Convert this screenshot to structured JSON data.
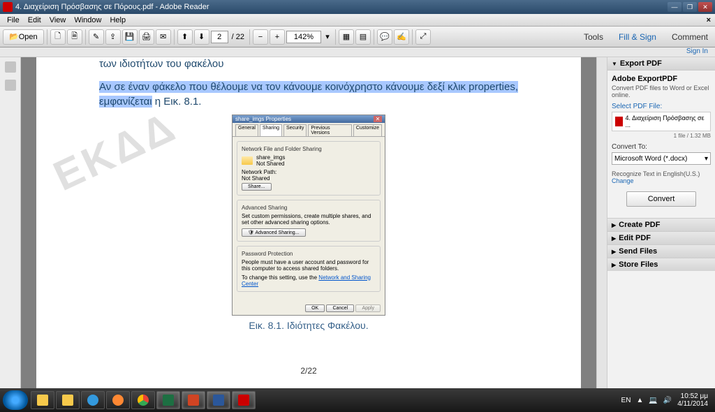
{
  "window": {
    "title": "4. Διαχείριση Πρόσβασης σε Πόρους.pdf - Adobe Reader",
    "min": "—",
    "max": "❐",
    "close": "✕"
  },
  "menu": {
    "file": "File",
    "edit": "Edit",
    "view": "View",
    "window": "Window",
    "help": "Help",
    "x": "×"
  },
  "toolbar": {
    "open": "Open",
    "page_current": "2",
    "page_total": "/ 22",
    "zoom": "142%",
    "tools": "Tools",
    "fillsign": "Fill & Sign",
    "comment": "Comment"
  },
  "signin": "Sign In",
  "doc": {
    "heading_line2": "των ιδιοτήτων του φακέλου",
    "para_hl1": "Αν ",
    "para_hl2": " σε έναν φάκελο που θέλουμε να τον κάνουμε ",
    "para_hl3": " κοινόχρηστο κάνουμε δεξί κλικ properties, εμφανίζεται",
    "para_tail": " η Εικ. 8.1.",
    "watermark": "ΕΚΔΔ",
    "caption": "Εικ. 8.1. Ιδιότητες Φακέλου.",
    "pagenum": "2/22"
  },
  "dialog": {
    "title": "share_imgs Properties",
    "tabs": {
      "general": "General",
      "sharing": "Sharing",
      "security": "Security",
      "prev": "Previous Versions",
      "custom": "Customize"
    },
    "sec1_title": "Network File and Folder Sharing",
    "share_name": "share_imgs",
    "not_shared": "Not Shared",
    "netpath": "Network Path:",
    "share_btn": "Share...",
    "sec2_title": "Advanced Sharing",
    "sec2_text": "Set custom permissions, create multiple shares, and set other advanced sharing options.",
    "adv_btn": "Advanced Sharing...",
    "sec3_title": "Password Protection",
    "sec3_text": "People must have a user account and password for this computer to access shared folders.",
    "sec3_text2": "To change this setting, use the ",
    "sec3_link": "Network and Sharing Center",
    "ok": "OK",
    "cancel": "Cancel",
    "apply": "Apply"
  },
  "rightpane": {
    "export": "Export PDF",
    "h": "Adobe ExportPDF",
    "sub": "Convert PDF files to Word or Excel online.",
    "select": "Select PDF File:",
    "filename": "4. Διαχείριση Πρόσβασης σε ...",
    "meta": "1 file / 1.32 MB",
    "convertto": "Convert To:",
    "format": "Microsoft Word (*.docx)",
    "recognize": "Recognize Text in English(U.S.)",
    "change": "Change",
    "convert": "Convert",
    "create": "Create PDF",
    "edit": "Edit PDF",
    "send": "Send Files",
    "store": "Store Files"
  },
  "tray": {
    "lang": "EN",
    "time": "10:52 μμ",
    "date": "4/11/2014"
  }
}
